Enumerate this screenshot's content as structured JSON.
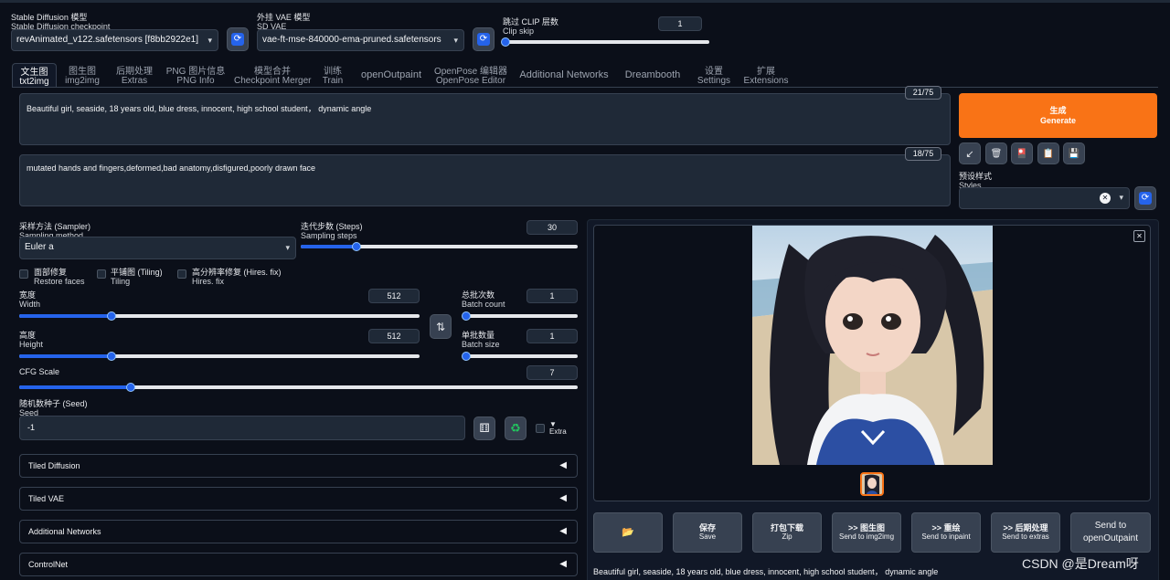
{
  "top": {
    "checkpoint_label": "Stable Diffusion 模型",
    "checkpoint_sublabel": "Stable Diffusion checkpoint",
    "checkpoint_value": "revAnimated_v122.safetensors [f8bb2922e1]",
    "vae_label": "外挂 VAE 模型",
    "vae_sublabel": "SD VAE",
    "vae_value": "vae-ft-mse-840000-ema-pruned.safetensors",
    "clip_label": "跳过 CLIP 层数",
    "clip_sublabel": "Clip skip",
    "clip_value": "1",
    "refresh_icon": "⟳"
  },
  "tabs": [
    {
      "cn": "文生图",
      "en": "txt2img"
    },
    {
      "cn": "图生图",
      "en": "img2img"
    },
    {
      "cn": "后期处理",
      "en": "Extras"
    },
    {
      "cn": "PNG 图片信息",
      "en": "PNG Info"
    },
    {
      "cn": "模型合并",
      "en": "Checkpoint Merger"
    },
    {
      "cn": "训练",
      "en": "Train"
    },
    {
      "cn": "openOutpaint",
      "en": ""
    },
    {
      "cn": "OpenPose 编辑器",
      "en": "OpenPose Editor"
    },
    {
      "cn": "Additional Networks",
      "en": ""
    },
    {
      "cn": "Dreambooth",
      "en": ""
    },
    {
      "cn": "设置",
      "en": "Settings"
    },
    {
      "cn": "扩展",
      "en": "Extensions"
    }
  ],
  "prompt": {
    "positive": "Beautiful girl, seaside, 18 years old, blue dress, innocent, high school student，  dynamic angle",
    "positive_count": "21/75",
    "negative": "mutated hands and fingers,deformed,bad anatomy,disfigured,poorly drawn face",
    "negative_count": "18/75"
  },
  "generate": {
    "cn": "生成",
    "en": "Generate",
    "color": "#f97316"
  },
  "tools": {
    "icons": [
      "↙",
      "🗑",
      "🎴",
      "📋",
      "💾"
    ]
  },
  "styles": {
    "label": "预设样式",
    "sublabel": "Styles",
    "clear": "✕",
    "arrow": "▾"
  },
  "sampler": {
    "method_label": "采样方法 (Sampler)",
    "method_sublabel": "Sampling method",
    "method_value": "Euler a",
    "steps_label": "迭代步数 (Steps)",
    "steps_sublabel": "Sampling steps",
    "steps_value": "30",
    "steps_fraction": 0.2
  },
  "checks": [
    {
      "cn": "面部修复",
      "en": "Restore faces"
    },
    {
      "cn": "平铺图 (Tiling)",
      "en": "Tiling"
    },
    {
      "cn": "高分辨率修复 (Hires. fix)",
      "en": "Hires. fix"
    }
  ],
  "size": {
    "width_label": "宽度",
    "width_sublabel": "Width",
    "width_value": "512",
    "width_fraction": 0.23,
    "height_label": "高度",
    "height_sublabel": "Height",
    "height_value": "512",
    "height_fraction": 0.23,
    "swap_icon": "⇅"
  },
  "batch": {
    "count_label": "总批次数",
    "count_sublabel": "Batch count",
    "count_value": "1",
    "count_fraction": 0.0,
    "size_label": "单批数量",
    "size_sublabel": "Batch size",
    "size_value": "1",
    "size_fraction": 0.0
  },
  "cfg": {
    "label": "CFG Scale",
    "value": "7",
    "fraction": 0.2
  },
  "seed": {
    "label": "随机数种子 (Seed)",
    "sublabel": "Seed",
    "value": "-1",
    "dice_icon": "⚅",
    "recycle_icon": "♻",
    "extra_arrow": "▼",
    "extra_label": "Extra"
  },
  "accordions": [
    "Tiled Diffusion",
    "Tiled VAE",
    "Additional Networks",
    "ControlNet"
  ],
  "accordion_arrow": "◀",
  "output": {
    "close_icon": "✕",
    "caption": "Beautiful girl, seaside, 18 years old, blue dress, innocent, high school student，  dynamic angle",
    "buttons": [
      {
        "cn": "📂",
        "en": ""
      },
      {
        "cn": "保存",
        "en": "Save"
      },
      {
        "cn": "打包下载",
        "en": "Zip"
      },
      {
        "cn": ">> 图生图",
        "en": "Send to img2img"
      },
      {
        "cn": ">> 重绘",
        "en": "Send to inpaint"
      },
      {
        "cn": ">> 后期处理",
        "en": "Send to extras"
      },
      {
        "cn": "Send to",
        "en": "openOutpaint"
      }
    ]
  },
  "watermark": "CSDN @是Dream呀"
}
